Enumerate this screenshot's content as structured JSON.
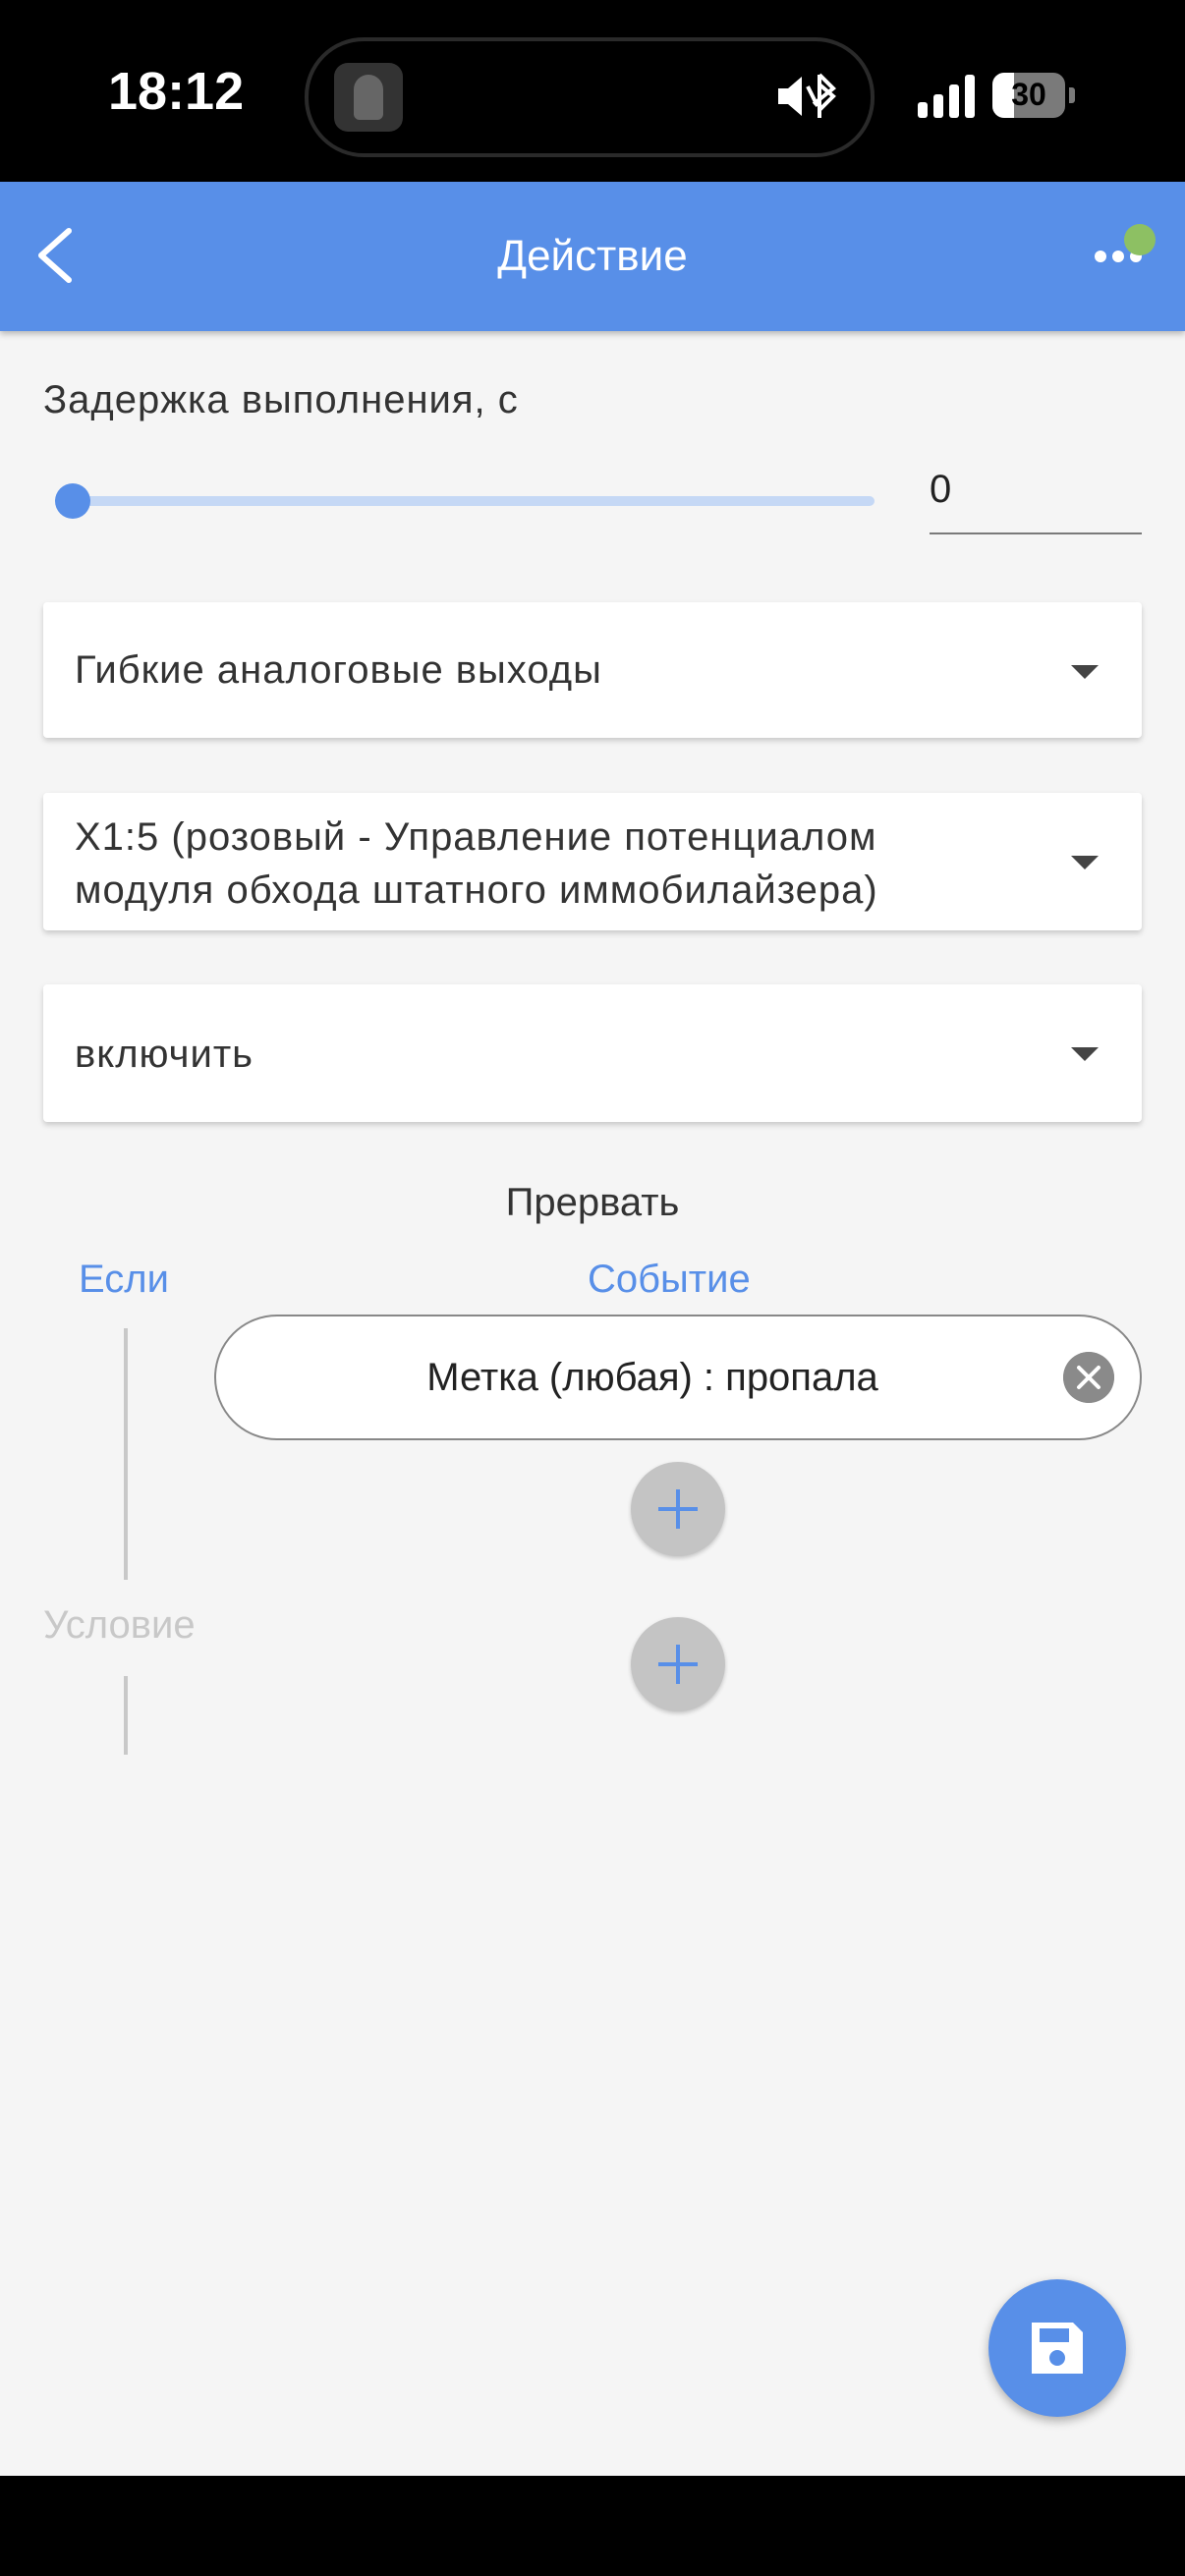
{
  "status_bar": {
    "time": "18:12",
    "battery_level": "30",
    "battery_fraction": 0.3
  },
  "header": {
    "title": "Действие",
    "status_dot_color": "#8dc063"
  },
  "delay": {
    "label": "Задержка выполнения, с",
    "value": "0",
    "slider_fraction": 0
  },
  "selects": [
    {
      "value": "Гибкие аналоговые выходы"
    },
    {
      "value_line1": "X1:5 (розовый - Управление потенциалом",
      "value_line2": "модуля обхода штатного иммобилайзера)"
    },
    {
      "value": "включить"
    }
  ],
  "interrupt": {
    "title": "Прервать",
    "if_label": "Если",
    "event_label": "Событие",
    "condition_label": "Условие",
    "event_chip": "Метка (любая) : пропала"
  },
  "colors": {
    "accent": "#588fe8",
    "background": "#f5f5f5"
  }
}
